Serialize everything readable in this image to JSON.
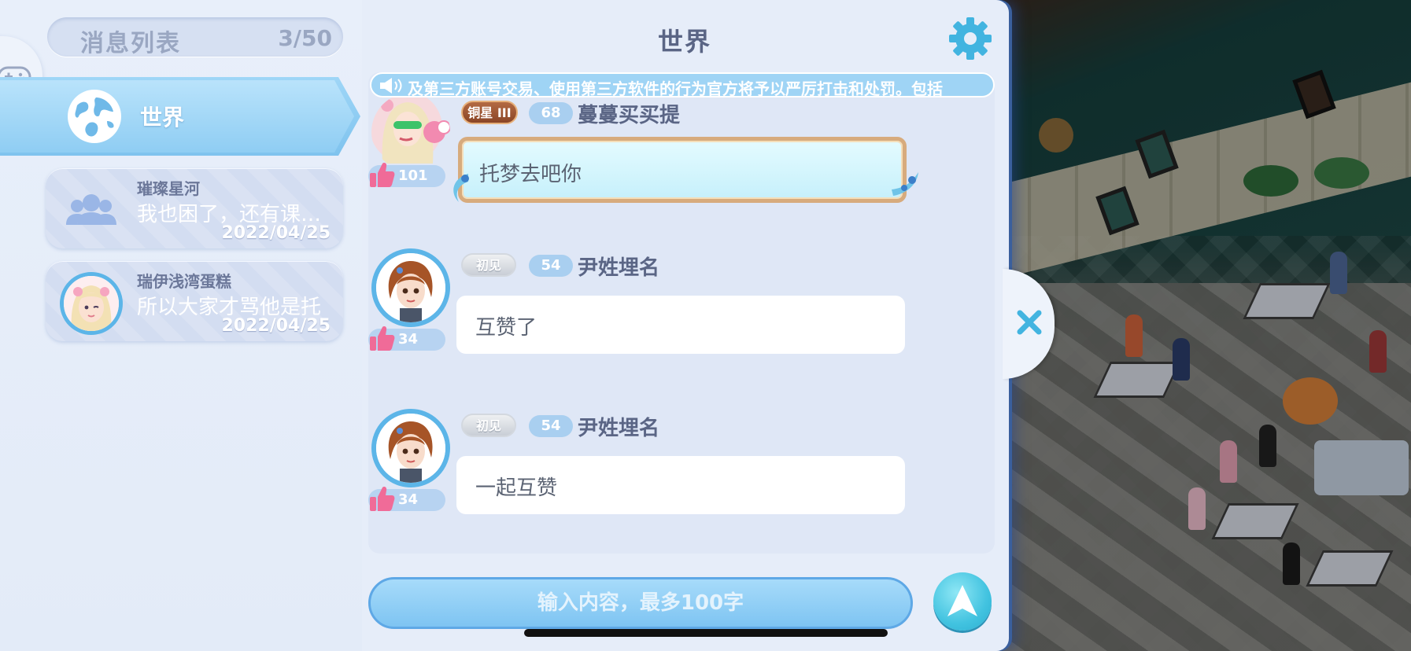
{
  "message_list": {
    "title": "消息列表",
    "count": "3/50"
  },
  "tabs": {
    "world_label": "世界"
  },
  "conversations": [
    {
      "name": "璀璨星河",
      "preview": "我也困了，还有课…",
      "date": "2022/04/25",
      "avatar": "group-icon"
    },
    {
      "name": "瑞伊浅湾蛋糕",
      "preview": "所以大家才骂他是托",
      "date": "2022/04/25",
      "avatar": "user-avatar"
    }
  ],
  "chat": {
    "title": "世界",
    "notice": "及第三方账号交易、使用第三方软件的行为官方将予以严厉打击和处罚。包括",
    "messages": [
      {
        "rank": "铜星 III",
        "level": "68",
        "name": "蔓蔓买买提",
        "likes": "101",
        "text": "托梦去吧你"
      },
      {
        "rank": "初见",
        "level": "54",
        "name": "尹姓埋名",
        "likes": "34",
        "text": "互赞了"
      },
      {
        "rank": "初见",
        "level": "54",
        "name": "尹姓埋名",
        "likes": "34",
        "text": "一起互赞"
      }
    ],
    "input_placeholder": "输入内容，最多100字"
  },
  "colors": {
    "panel_bg": "#e6edf9",
    "accent_blue": "#7fc3ee",
    "like_pink": "#f06b98",
    "title_text": "#5a6585"
  }
}
